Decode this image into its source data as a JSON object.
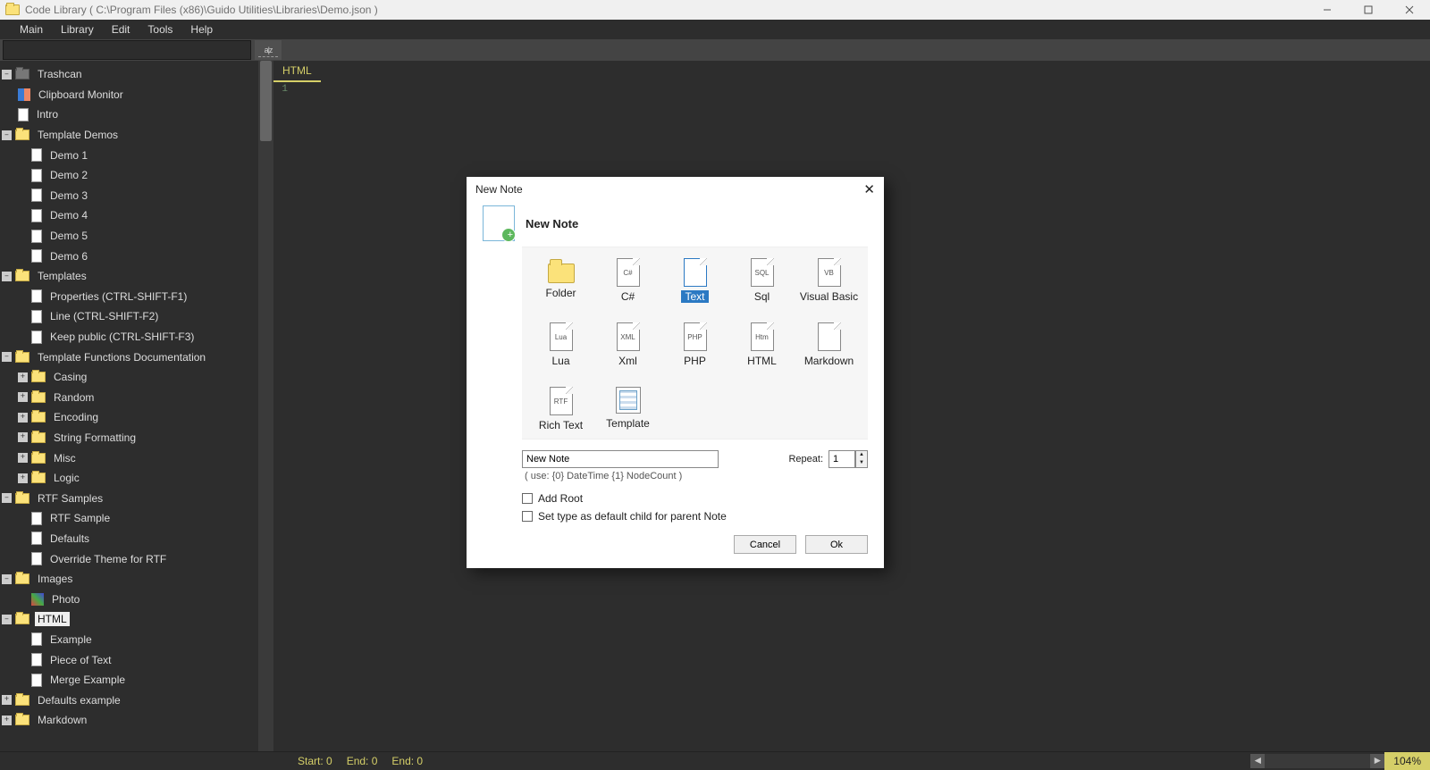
{
  "window": {
    "title": "Code Library ( C:\\Program Files (x86)\\Guido Utilities\\Libraries\\Demo.json )"
  },
  "menu": {
    "items": [
      "Main",
      "Library",
      "Edit",
      "Tools",
      "Help"
    ]
  },
  "subbar": {
    "search_value": "",
    "filter_label": "a|z"
  },
  "tree": [
    {
      "t": "–",
      "icon": "special",
      "label": "Trashcan",
      "indent": 0
    },
    {
      "t": "",
      "icon": "clipboard",
      "label": "Clipboard Monitor",
      "indent": 1
    },
    {
      "t": "",
      "icon": "file",
      "label": "Intro",
      "indent": 1
    },
    {
      "t": "–",
      "icon": "folder",
      "label": "Template Demos",
      "indent": 0
    },
    {
      "t": "",
      "icon": "file",
      "label": "Demo 1",
      "indent": 1,
      "pad": 1
    },
    {
      "t": "",
      "icon": "file",
      "label": "Demo 2",
      "indent": 1,
      "pad": 1
    },
    {
      "t": "",
      "icon": "file",
      "label": "Demo 3",
      "indent": 1,
      "pad": 1
    },
    {
      "t": "",
      "icon": "file",
      "label": "Demo 4",
      "indent": 1,
      "pad": 1
    },
    {
      "t": "",
      "icon": "file",
      "label": "Demo 5",
      "indent": 1,
      "pad": 1
    },
    {
      "t": "",
      "icon": "file",
      "label": "Demo 6",
      "indent": 1,
      "pad": 1
    },
    {
      "t": "–",
      "icon": "folder",
      "label": "Templates",
      "indent": 0
    },
    {
      "t": "",
      "icon": "file",
      "label": "Properties (CTRL-SHIFT-F1)",
      "indent": 1,
      "pad": 1
    },
    {
      "t": "",
      "icon": "file",
      "label": "Line (CTRL-SHIFT-F2)",
      "indent": 1,
      "pad": 1
    },
    {
      "t": "",
      "icon": "file",
      "label": "Keep public (CTRL-SHIFT-F3)",
      "indent": 1,
      "pad": 1
    },
    {
      "t": "–",
      "icon": "folder",
      "label": "Template Functions Documentation",
      "indent": 0
    },
    {
      "t": "+",
      "icon": "folder",
      "label": "Casing",
      "indent": 1
    },
    {
      "t": "+",
      "icon": "folder",
      "label": "Random",
      "indent": 1
    },
    {
      "t": "+",
      "icon": "folder",
      "label": "Encoding",
      "indent": 1
    },
    {
      "t": "+",
      "icon": "folder",
      "label": "String Formatting",
      "indent": 1
    },
    {
      "t": "+",
      "icon": "folder",
      "label": "Misc",
      "indent": 1
    },
    {
      "t": "+",
      "icon": "folder",
      "label": "Logic",
      "indent": 1
    },
    {
      "t": "–",
      "icon": "folder",
      "label": "RTF Samples",
      "indent": 0
    },
    {
      "t": "",
      "icon": "file",
      "label": "RTF Sample",
      "indent": 1,
      "pad": 1
    },
    {
      "t": "",
      "icon": "file",
      "label": "Defaults",
      "indent": 1,
      "pad": 1
    },
    {
      "t": "",
      "icon": "file",
      "label": "Override Theme for RTF",
      "indent": 1,
      "pad": 1
    },
    {
      "t": "–",
      "icon": "folder",
      "label": "Images",
      "indent": 0
    },
    {
      "t": "",
      "icon": "photo",
      "label": "Photo",
      "indent": 1,
      "pad": 1
    },
    {
      "t": "–",
      "icon": "folder",
      "label": "HTML",
      "indent": 0,
      "selected": true
    },
    {
      "t": "",
      "icon": "file",
      "label": "Example",
      "indent": 1,
      "pad": 1
    },
    {
      "t": "",
      "icon": "file",
      "label": "Piece of Text",
      "indent": 1,
      "pad": 1
    },
    {
      "t": "",
      "icon": "file",
      "label": "Merge Example",
      "indent": 1,
      "pad": 1
    },
    {
      "t": "+",
      "icon": "folder",
      "label": "Defaults example",
      "indent": 0
    },
    {
      "t": "+",
      "icon": "folder",
      "label": "Markdown",
      "indent": 0
    }
  ],
  "editor": {
    "tab": "HTML",
    "line_number": "1"
  },
  "status": {
    "start": "Start:   0",
    "end1": "End:   0",
    "end2": "End:   0",
    "zoom": "104%"
  },
  "dialog": {
    "title": "New Note",
    "heading": "New Note",
    "types": [
      {
        "label": "Folder",
        "icon": "folder"
      },
      {
        "label": "C#",
        "icon": "doc",
        "tag": "C#"
      },
      {
        "label": "Text",
        "icon": "doc",
        "tag": "",
        "selected": true
      },
      {
        "label": "Sql",
        "icon": "doc",
        "tag": "SQL"
      },
      {
        "label": "Visual Basic",
        "icon": "doc",
        "tag": "VB"
      },
      {
        "label": "Lua",
        "icon": "doc",
        "tag": "Lua"
      },
      {
        "label": "Xml",
        "icon": "doc",
        "tag": "XML"
      },
      {
        "label": "PHP",
        "icon": "doc",
        "tag": "PHP"
      },
      {
        "label": "HTML",
        "icon": "doc",
        "tag": "Htm"
      },
      {
        "label": "Markdown",
        "icon": "doc",
        "tag": ""
      },
      {
        "label": "Rich Text",
        "icon": "doc",
        "tag": "RTF"
      },
      {
        "label": "Template",
        "icon": "tmpl"
      }
    ],
    "name_value": "New Note",
    "hint": "( use: {0} DateTime {1} NodeCount )",
    "repeat_label": "Repeat:",
    "repeat_value": "1",
    "chk_addroot": "Add Root",
    "chk_default": "Set type as default child for parent Note",
    "btn_cancel": "Cancel",
    "btn_ok": "Ok"
  }
}
